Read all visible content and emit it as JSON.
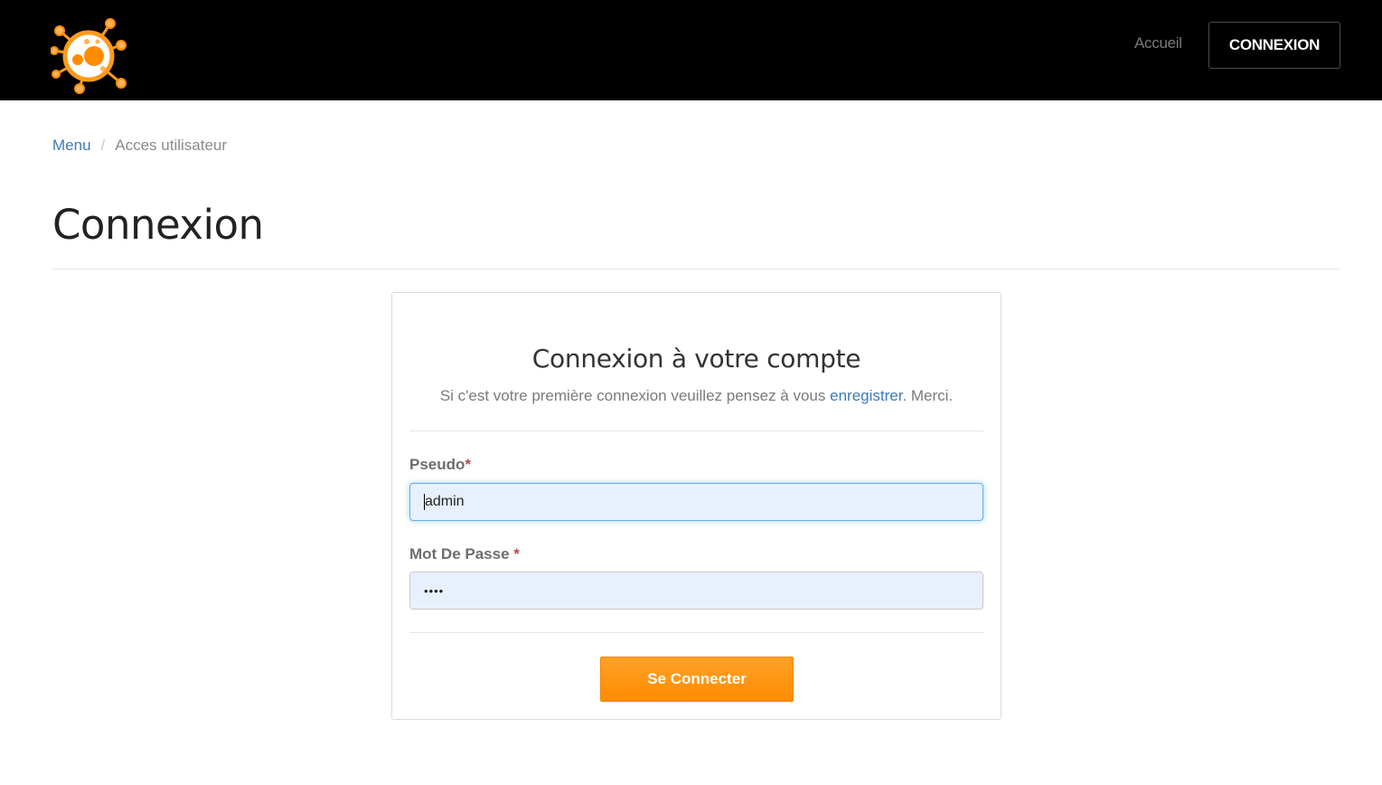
{
  "header": {
    "logo_icon": "virus-logo-icon",
    "nav_home": "Accueil",
    "nav_login": "CONNEXION"
  },
  "breadcrumb": {
    "home": "Menu",
    "separator": "/",
    "current": "Acces utilisateur"
  },
  "page": {
    "title": "Connexion"
  },
  "form": {
    "title": "Connexion à votre compte",
    "subtitle_prefix": "Si c'est votre première connexion veuillez pensez à vous ",
    "subtitle_link": "enregistrer",
    "subtitle_suffix": ". Merci.",
    "username_label": "Pseudo",
    "username_required": "*",
    "username_value": "admin",
    "password_label": "Mot De Passe ",
    "password_required": "*",
    "password_value": "••••",
    "submit_label": "Se Connecter"
  },
  "colors": {
    "header_bg": "#000000",
    "link": "#3d7ab8",
    "accent": "#ff8c00",
    "required": "#b94a48",
    "input_bg": "#e8f0fe"
  }
}
